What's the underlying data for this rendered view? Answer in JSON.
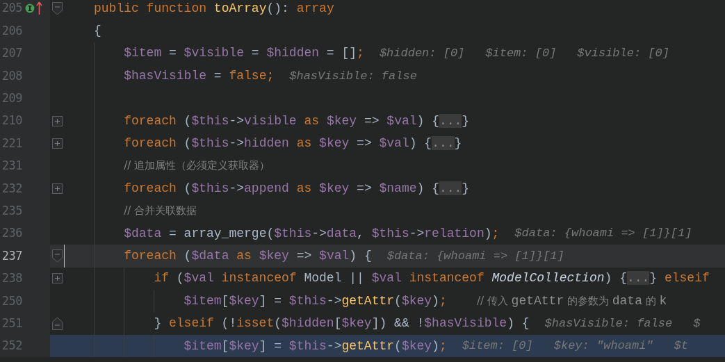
{
  "lines": [
    {
      "number": "205",
      "fold": {
        "kind": "start"
      },
      "current": false,
      "execution": false,
      "markers": [
        {
          "kind": "implements"
        },
        {
          "kind": "overrides"
        }
      ],
      "tokens": [
        {
          "kind": "kw",
          "text": "public function "
        },
        {
          "kind": "fn",
          "text": "toArray"
        },
        {
          "kind": "plain",
          "text": "(): "
        },
        {
          "kind": "kw",
          "text": "array"
        }
      ]
    },
    {
      "number": "206",
      "current": false,
      "execution": false,
      "tokens": [
        {
          "kind": "plain",
          "text": "{"
        }
      ],
      "children": [
        {
          "number": "207",
          "current": false,
          "execution": false,
          "tokens": [
            {
              "kind": "var",
              "text": "$item"
            },
            {
              "kind": "plain",
              "text": " = "
            },
            {
              "kind": "var",
              "text": "$visible"
            },
            {
              "kind": "plain",
              "text": " = "
            },
            {
              "kind": "var",
              "text": "$hidden"
            },
            {
              "kind": "plain",
              "text": " = []"
            },
            {
              "kind": "kw",
              "text": ";"
            }
          ],
          "hints": [
            "$hidden: [0]",
            "$item: [0]",
            "$visible: [0]"
          ]
        },
        {
          "number": "208",
          "current": false,
          "execution": false,
          "tokens": [
            {
              "kind": "var",
              "text": "$hasVisible"
            },
            {
              "kind": "plain",
              "text": " = "
            },
            {
              "kind": "kw",
              "text": "false;"
            }
          ],
          "hints": [
            "$hasVisible: false"
          ]
        },
        {
          "number": "209",
          "current": false,
          "execution": false
        },
        {
          "number": "210",
          "fold": {
            "kind": "collapsed"
          },
          "current": false,
          "execution": false,
          "tokens": [
            {
              "kind": "kw",
              "text": "foreach"
            },
            {
              "kind": "plain",
              "text": " ("
            },
            {
              "kind": "var",
              "text": "$this"
            },
            {
              "kind": "plain",
              "text": "->"
            },
            {
              "kind": "var",
              "text": "visible"
            },
            {
              "kind": "kw",
              "text": " as "
            },
            {
              "kind": "var",
              "text": "$key"
            },
            {
              "kind": "plain",
              "text": " => "
            },
            {
              "kind": "var",
              "text": "$val"
            },
            {
              "kind": "plain",
              "text": ") {"
            },
            {
              "kind": "folded",
              "text": "..."
            },
            {
              "kind": "plain",
              "text": "}"
            }
          ]
        },
        {
          "number": "221",
          "fold": {
            "kind": "collapsed"
          },
          "current": false,
          "execution": false,
          "tokens": [
            {
              "kind": "kw",
              "text": "foreach"
            },
            {
              "kind": "plain",
              "text": " ("
            },
            {
              "kind": "var",
              "text": "$this"
            },
            {
              "kind": "plain",
              "text": "->"
            },
            {
              "kind": "var",
              "text": "hidden"
            },
            {
              "kind": "kw",
              "text": " as "
            },
            {
              "kind": "var",
              "text": "$key"
            },
            {
              "kind": "plain",
              "text": " => "
            },
            {
              "kind": "var",
              "text": "$val"
            },
            {
              "kind": "plain",
              "text": ") {"
            },
            {
              "kind": "folded",
              "text": "..."
            },
            {
              "kind": "plain",
              "text": "}"
            }
          ]
        },
        {
          "number": "231",
          "current": false,
          "execution": false,
          "tokens": [
            {
              "kind": "comment",
              "text": "// 追加属性（必须定义获取器）"
            }
          ]
        },
        {
          "number": "232",
          "fold": {
            "kind": "collapsed"
          },
          "current": false,
          "execution": false,
          "tokens": [
            {
              "kind": "kw",
              "text": "foreach"
            },
            {
              "kind": "plain",
              "text": " ("
            },
            {
              "kind": "var",
              "text": "$this"
            },
            {
              "kind": "plain",
              "text": "->"
            },
            {
              "kind": "var",
              "text": "append"
            },
            {
              "kind": "kw",
              "text": " as "
            },
            {
              "kind": "var",
              "text": "$key"
            },
            {
              "kind": "plain",
              "text": " => "
            },
            {
              "kind": "var",
              "text": "$name"
            },
            {
              "kind": "plain",
              "text": ") {"
            },
            {
              "kind": "folded",
              "text": "..."
            },
            {
              "kind": "plain",
              "text": "}"
            }
          ]
        },
        {
          "number": "235",
          "current": false,
          "execution": false,
          "tokens": [
            {
              "kind": "comment",
              "text": "// 合并关联数据"
            }
          ]
        },
        {
          "number": "236",
          "current": false,
          "execution": false,
          "tokens": [
            {
              "kind": "var",
              "text": "$data"
            },
            {
              "kind": "plain",
              "text": " = array_merge("
            },
            {
              "kind": "var",
              "text": "$this"
            },
            {
              "kind": "plain",
              "text": "->"
            },
            {
              "kind": "var",
              "text": "data"
            },
            {
              "kind": "plain",
              "text": ", "
            },
            {
              "kind": "var",
              "text": "$this"
            },
            {
              "kind": "plain",
              "text": "->"
            },
            {
              "kind": "var",
              "text": "relation"
            },
            {
              "kind": "plain",
              "text": ")"
            },
            {
              "kind": "kw",
              "text": ";"
            }
          ],
          "hints": [
            "$data: {whoami => [1]}[1]"
          ]
        },
        {
          "number": "237",
          "fold": {
            "kind": "start"
          },
          "current": true,
          "execution": false,
          "tokens": [
            {
              "kind": "kw",
              "text": "foreach"
            },
            {
              "kind": "plain",
              "text": " ("
            },
            {
              "kind": "var",
              "text": "$data"
            },
            {
              "kind": "kw",
              "text": " as "
            },
            {
              "kind": "var",
              "text": "$key"
            },
            {
              "kind": "plain",
              "text": " => "
            },
            {
              "kind": "var",
              "text": "$val"
            },
            {
              "kind": "plain",
              "text": ") {"
            }
          ],
          "hints": [
            "$data: {whoami => [1]}[1]"
          ],
          "children": [
            {
              "number": "238",
              "fold": {
                "kind": "collapsed"
              },
              "current": false,
              "execution": false,
              "tokens": [
                {
                  "kind": "kw",
                  "text": "if"
                },
                {
                  "kind": "plain",
                  "text": " ("
                },
                {
                  "kind": "var",
                  "text": "$val"
                },
                {
                  "kind": "kw",
                  "text": " instanceof "
                },
                {
                  "kind": "plain",
                  "text": "Model || "
                },
                {
                  "kind": "var",
                  "text": "$val"
                },
                {
                  "kind": "kw",
                  "text": " instanceof "
                },
                {
                  "kind": "cls",
                  "text": "ModelCollection"
                },
                {
                  "kind": "plain",
                  "text": ") {"
                },
                {
                  "kind": "folded",
                  "text": "..."
                },
                {
                  "kind": "plain",
                  "text": "} "
                },
                {
                  "kind": "kw",
                  "text": "elseif"
                }
              ],
              "children": [
                {
                  "number": "250",
                  "current": false,
                  "execution": false,
                  "tokens": [
                    {
                      "kind": "var",
                      "text": "$item"
                    },
                    {
                      "kind": "plain",
                      "text": "["
                    },
                    {
                      "kind": "var",
                      "text": "$key"
                    },
                    {
                      "kind": "plain",
                      "text": "] = "
                    },
                    {
                      "kind": "var",
                      "text": "$this"
                    },
                    {
                      "kind": "plain",
                      "text": "->"
                    },
                    {
                      "kind": "fn",
                      "text": "getAttr"
                    },
                    {
                      "kind": "plain",
                      "text": "("
                    },
                    {
                      "kind": "var",
                      "text": "$key"
                    },
                    {
                      "kind": "plain",
                      "text": ")"
                    },
                    {
                      "kind": "kw",
                      "text": ";    "
                    },
                    {
                      "kind": "comment",
                      "text": "// 传入 "
                    },
                    {
                      "kind": "commentcode",
                      "text": "getAttr"
                    },
                    {
                      "kind": "comment",
                      "text": " 的参数为 "
                    },
                    {
                      "kind": "commentcode",
                      "text": "data"
                    },
                    {
                      "kind": "comment",
                      "text": " 的 "
                    },
                    {
                      "kind": "commentcode",
                      "text": "k"
                    }
                  ]
                }
              ]
            },
            {
              "number": "251",
              "fold": {
                "kind": "end"
              },
              "current": false,
              "execution": false,
              "tokens": [
                {
                  "kind": "plain",
                  "text": "} "
                },
                {
                  "kind": "kw",
                  "text": "elseif"
                },
                {
                  "kind": "plain",
                  "text": " (!"
                },
                {
                  "kind": "kw",
                  "text": "isset"
                },
                {
                  "kind": "plain",
                  "text": "("
                },
                {
                  "kind": "var",
                  "text": "$hidden"
                },
                {
                  "kind": "plain",
                  "text": "["
                },
                {
                  "kind": "var",
                  "text": "$key"
                },
                {
                  "kind": "plain",
                  "text": "]) && !"
                },
                {
                  "kind": "var",
                  "text": "$hasVisible"
                },
                {
                  "kind": "plain",
                  "text": ") {"
                }
              ],
              "hints": [
                "$hasVisible: false",
                "$"
              ],
              "children": [
                {
                  "number": "252",
                  "current": false,
                  "execution": true,
                  "tokens": [
                    {
                      "kind": "var",
                      "text": "$item"
                    },
                    {
                      "kind": "plain",
                      "text": "["
                    },
                    {
                      "kind": "var",
                      "text": "$key"
                    },
                    {
                      "kind": "plain",
                      "text": "] = "
                    },
                    {
                      "kind": "var",
                      "text": "$this"
                    },
                    {
                      "kind": "plain",
                      "text": "->"
                    },
                    {
                      "kind": "fn",
                      "text": "getAttr"
                    },
                    {
                      "kind": "plain",
                      "text": "("
                    },
                    {
                      "kind": "var",
                      "text": "$key"
                    },
                    {
                      "kind": "plain",
                      "text": ")"
                    },
                    {
                      "kind": "kw",
                      "text": ";"
                    }
                  ],
                  "hints": [
                    "$item: [0]",
                    "$key: \"whoami\"",
                    "$t"
                  ]
                }
              ]
            }
          ]
        }
      ]
    }
  ]
}
